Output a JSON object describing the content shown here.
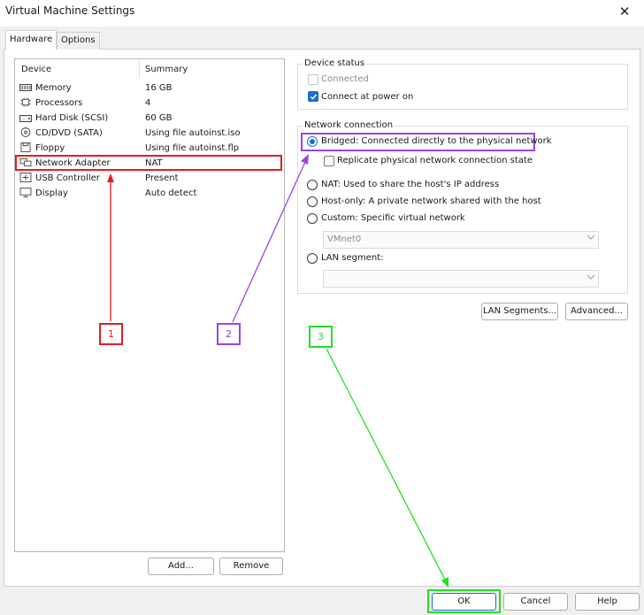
{
  "window": {
    "title": "Virtual Machine Settings",
    "close_glyph": "✕"
  },
  "tabs": [
    {
      "label": "Hardware",
      "active": true
    },
    {
      "label": "Options",
      "active": false
    }
  ],
  "device_list": {
    "headers": {
      "device": "Device",
      "summary": "Summary"
    },
    "rows": [
      {
        "name": "Memory",
        "summary": "16 GB",
        "icon": "memory-icon"
      },
      {
        "name": "Processors",
        "summary": "4",
        "icon": "processor-icon"
      },
      {
        "name": "Hard Disk (SCSI)",
        "summary": "60 GB",
        "icon": "hard-disk-icon"
      },
      {
        "name": "CD/DVD (SATA)",
        "summary": "Using file autoinst.iso",
        "icon": "cd-dvd-icon"
      },
      {
        "name": "Floppy",
        "summary": "Using file autoinst.flp",
        "icon": "floppy-icon"
      },
      {
        "name": "Network Adapter",
        "summary": "NAT",
        "icon": "network-adapter-icon"
      },
      {
        "name": "USB Controller",
        "summary": "Present",
        "icon": "usb-icon"
      },
      {
        "name": "Display",
        "summary": "Auto detect",
        "icon": "display-icon"
      }
    ],
    "add_label": "Add...",
    "remove_label": "Remove"
  },
  "device_status": {
    "label": "Device status",
    "connected": "Connected",
    "connect_at_power_on": "Connect at power on"
  },
  "network_connection": {
    "label": "Network connection",
    "bridged": "Bridged: Connected directly to the physical network",
    "replicate": "Replicate physical network connection state",
    "nat": "NAT: Used to share the host's IP address",
    "host_only": "Host-only: A private network shared with the host",
    "custom": "Custom: Specific virtual network",
    "vmnet_value": "VMnet0",
    "lan_segment": "LAN segment:",
    "lan_segment_value": ""
  },
  "buttons": {
    "lan_segments": "LAN Segments...",
    "advanced": "Advanced...",
    "ok": "OK",
    "cancel": "Cancel",
    "help": "Help"
  },
  "annotations": {
    "one": "1",
    "two": "2",
    "three": "3",
    "colors": {
      "red": "#e01e1e",
      "purple": "#9b45e8",
      "green": "#22e022"
    }
  },
  "colors": {
    "accent": "#1b6fcf"
  }
}
